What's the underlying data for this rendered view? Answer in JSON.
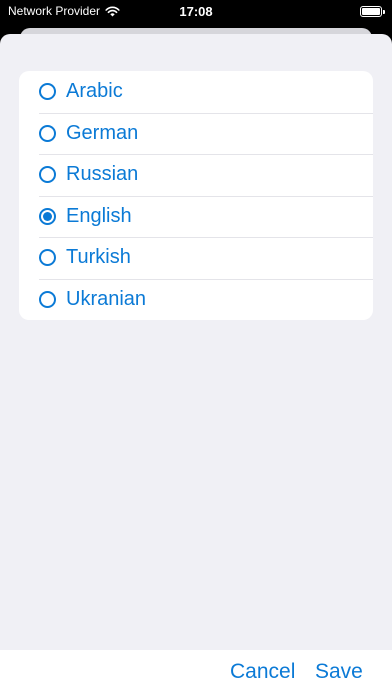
{
  "status_bar": {
    "carrier": "Network Provider",
    "time": "17:08",
    "wifi_icon": "wifi-icon",
    "battery_icon": "battery-icon"
  },
  "language_list": {
    "selected": "English",
    "items": [
      {
        "label": "Arabic",
        "selected": false
      },
      {
        "label": "German",
        "selected": false
      },
      {
        "label": "Russian",
        "selected": false
      },
      {
        "label": "English",
        "selected": true
      },
      {
        "label": "Turkish",
        "selected": false
      },
      {
        "label": "Ukranian",
        "selected": false
      }
    ]
  },
  "toolbar": {
    "cancel_label": "Cancel",
    "save_label": "Save"
  },
  "colors": {
    "accent": "#0b7ad6",
    "sheet_background": "#f0f0f5",
    "card_background": "#ffffff",
    "status_bar_background": "#000000"
  }
}
